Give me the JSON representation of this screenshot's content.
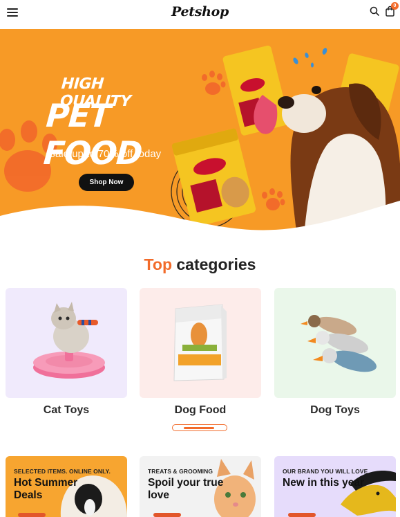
{
  "header": {
    "logo": "Petshop",
    "cart_count": "0",
    "icons": [
      "menu-icon",
      "search-icon",
      "cart-icon"
    ]
  },
  "hero": {
    "line1": "HIGH QUALITY",
    "line2": "PET FOOD",
    "sale_text": "Sale up to 70% off today",
    "button_label": "Shop Now"
  },
  "categories_section": {
    "title_accent": "Top",
    "title_rest": " categories",
    "items": [
      {
        "label": "Cat Toys",
        "bg": "#f0eafc"
      },
      {
        "label": "Dog Food",
        "bg": "#fdecea"
      },
      {
        "label": "Dog Toys",
        "bg": "#eaf7ea"
      }
    ]
  },
  "promos": [
    {
      "tag": "SELECTED ITEMS. ONLINE ONLY.",
      "title": "Hot Summer Deals",
      "bg": "#f7a530"
    },
    {
      "tag": "TREATS & GROOMING",
      "title": "Spoil your true love",
      "bg": "#f2f2f2"
    },
    {
      "tag": "OUR BRAND YOU WILL LOVE",
      "title": "New in this year",
      "bg": "#e6dcfb"
    }
  ],
  "colors": {
    "accent": "#f26b2a",
    "hero_bg": "#f79a26"
  }
}
